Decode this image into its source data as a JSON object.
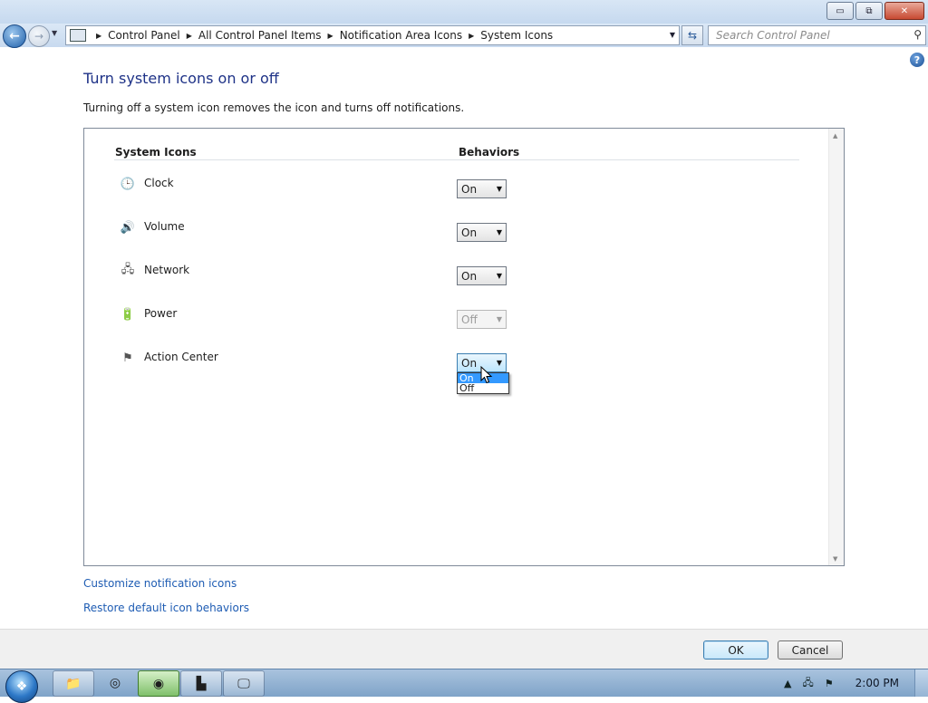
{
  "window": {
    "caption_buttons": {
      "minimize": "▭",
      "maximize": "⧉",
      "close": "✕"
    }
  },
  "nav": {
    "back_icon": "back-arrow-icon",
    "forward_icon": "forward-arrow-icon",
    "breadcrumbs": [
      "Control Panel",
      "All Control Panel Items",
      "Notification Area Icons",
      "System Icons"
    ],
    "search_placeholder": "Search Control Panel"
  },
  "page": {
    "title": "Turn system icons on or off",
    "description": "Turning off a system icon removes the icon and turns off notifications.",
    "help_label": "?"
  },
  "table": {
    "header_icons": "System Icons",
    "header_behaviors": "Behaviors",
    "rows": [
      {
        "label": "Clock",
        "value": "On",
        "icon": "clock-icon",
        "glyph": "🕒",
        "disabled": false
      },
      {
        "label": "Volume",
        "value": "On",
        "icon": "volume-icon",
        "glyph": "🔊",
        "disabled": false
      },
      {
        "label": "Network",
        "value": "On",
        "icon": "network-icon",
        "glyph": "🖧",
        "disabled": false
      },
      {
        "label": "Power",
        "value": "Off",
        "icon": "power-icon",
        "glyph": "🔋",
        "disabled": true
      },
      {
        "label": "Action Center",
        "value": "On",
        "icon": "flag-icon",
        "glyph": "⚑",
        "disabled": false
      }
    ],
    "dropdown_options": [
      "On",
      "Off"
    ],
    "dropdown_selected": "On"
  },
  "links": {
    "customize": "Customize notification icons",
    "restore": "Restore default icon behaviors"
  },
  "buttons": {
    "ok": "OK",
    "cancel": "Cancel"
  },
  "taskbar": {
    "clock": "2:00 PM",
    "apps": [
      "explorer-icon",
      "ie-icon",
      "media-player-icon",
      "control-panel-icon",
      "remote-desktop-icon"
    ]
  },
  "colors": {
    "title": "#1e3287",
    "link": "#1e5cb3",
    "selection": "#3399ff"
  }
}
